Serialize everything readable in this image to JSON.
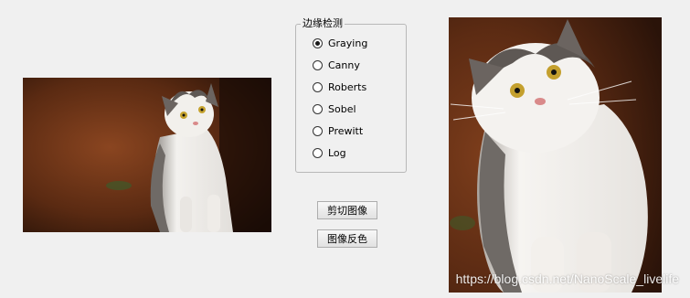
{
  "edge_detection": {
    "title": "边缘检测",
    "options": [
      {
        "label": "Graying",
        "checked": true
      },
      {
        "label": "Canny",
        "checked": false
      },
      {
        "label": "Roberts",
        "checked": false
      },
      {
        "label": "Sobel",
        "checked": false
      },
      {
        "label": "Prewitt",
        "checked": false
      },
      {
        "label": "Log",
        "checked": false
      }
    ]
  },
  "buttons": {
    "crop_label": "剪切图像",
    "invert_label": "图像反色"
  },
  "watermark": "https://blog.csdn.net/NanoScale_livelife",
  "colors": {
    "background": "#f0f0f0",
    "photo_bg_dark": "#3a1c0c",
    "photo_bg_warm": "#7a3a18",
    "cat_white": "#f4f2ef",
    "cat_gray": "#6f6a66"
  }
}
